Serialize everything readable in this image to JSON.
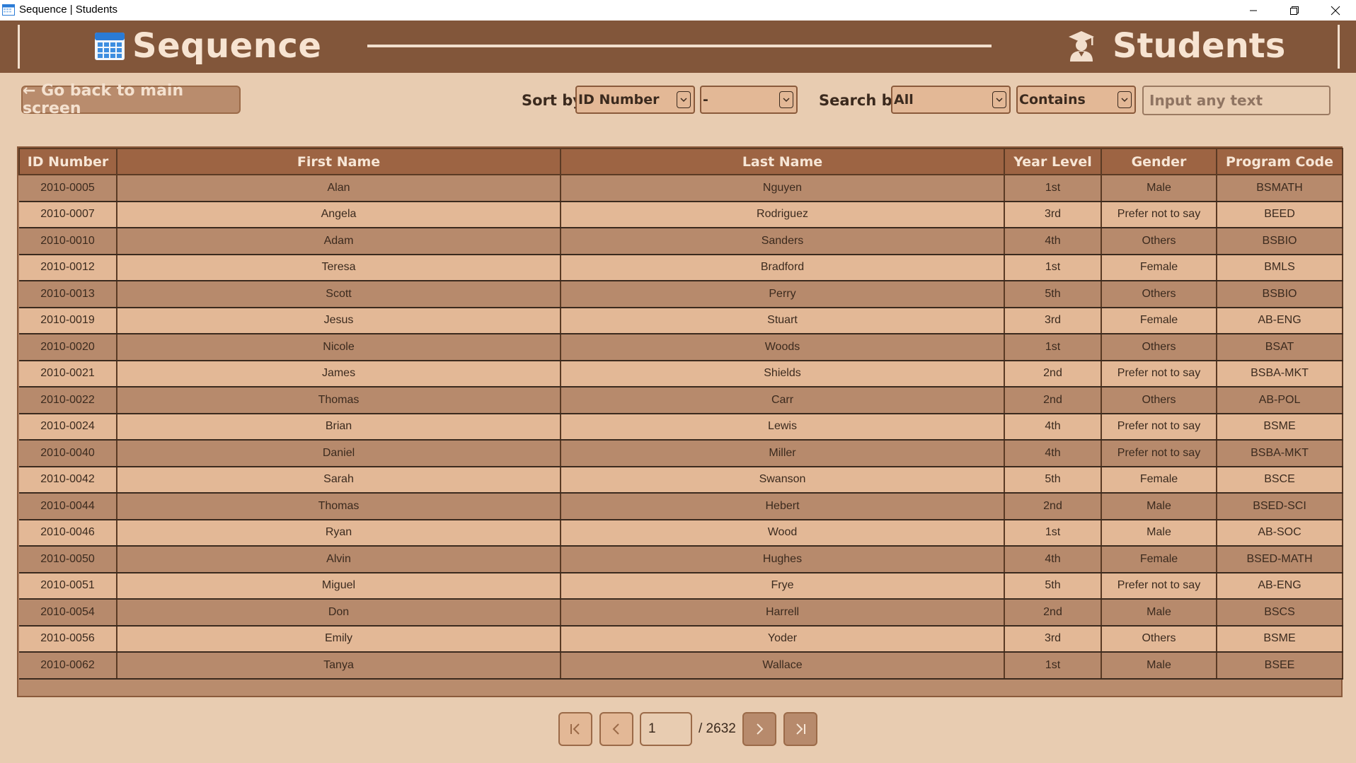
{
  "window": {
    "title": "Sequence | Students"
  },
  "header": {
    "app_name": "Sequence",
    "section_title": "Students"
  },
  "toolbar": {
    "back_label": "← Go back to main screen",
    "sort_label": "Sort by",
    "sort_field": "ID Number",
    "sort_order": "-",
    "search_label": "Search by",
    "search_field": "All",
    "search_mode": "Contains",
    "search_placeholder": "Input any text"
  },
  "table": {
    "columns": [
      "ID Number",
      "First Name",
      "Last Name",
      "Year Level",
      "Gender",
      "Program Code"
    ],
    "rows": [
      [
        "2010-0005",
        "Alan",
        "Nguyen",
        "1st",
        "Male",
        "BSMATH"
      ],
      [
        "2010-0007",
        "Angela",
        "Rodriguez",
        "3rd",
        "Prefer not to say",
        "BEED"
      ],
      [
        "2010-0010",
        "Adam",
        "Sanders",
        "4th",
        "Others",
        "BSBIO"
      ],
      [
        "2010-0012",
        "Teresa",
        "Bradford",
        "1st",
        "Female",
        "BMLS"
      ],
      [
        "2010-0013",
        "Scott",
        "Perry",
        "5th",
        "Others",
        "BSBIO"
      ],
      [
        "2010-0019",
        "Jesus",
        "Stuart",
        "3rd",
        "Female",
        "AB-ENG"
      ],
      [
        "2010-0020",
        "Nicole",
        "Woods",
        "1st",
        "Others",
        "BSAT"
      ],
      [
        "2010-0021",
        "James",
        "Shields",
        "2nd",
        "Prefer not to say",
        "BSBA-MKT"
      ],
      [
        "2010-0022",
        "Thomas",
        "Carr",
        "2nd",
        "Others",
        "AB-POL"
      ],
      [
        "2010-0024",
        "Brian",
        "Lewis",
        "4th",
        "Prefer not to say",
        "BSME"
      ],
      [
        "2010-0040",
        "Daniel",
        "Miller",
        "4th",
        "Prefer not to say",
        "BSBA-MKT"
      ],
      [
        "2010-0042",
        "Sarah",
        "Swanson",
        "5th",
        "Female",
        "BSCE"
      ],
      [
        "2010-0044",
        "Thomas",
        "Hebert",
        "2nd",
        "Male",
        "BSED-SCI"
      ],
      [
        "2010-0046",
        "Ryan",
        "Wood",
        "1st",
        "Male",
        "AB-SOC"
      ],
      [
        "2010-0050",
        "Alvin",
        "Hughes",
        "4th",
        "Female",
        "BSED-MATH"
      ],
      [
        "2010-0051",
        "Miguel",
        "Frye",
        "5th",
        "Prefer not to say",
        "AB-ENG"
      ],
      [
        "2010-0054",
        "Don",
        "Harrell",
        "2nd",
        "Male",
        "BSCS"
      ],
      [
        "2010-0056",
        "Emily",
        "Yoder",
        "3rd",
        "Others",
        "BSME"
      ],
      [
        "2010-0062",
        "Tanya",
        "Wallace",
        "1st",
        "Male",
        "BSEE"
      ]
    ]
  },
  "pagination": {
    "current_page": "1",
    "total_label": "/ 2632"
  },
  "colors": {
    "header_bg": "#82563a",
    "page_bg": "#e8ccb1",
    "row_dark": "#b78a6c",
    "row_light": "#e3b896",
    "th_bg": "#9d6443"
  }
}
